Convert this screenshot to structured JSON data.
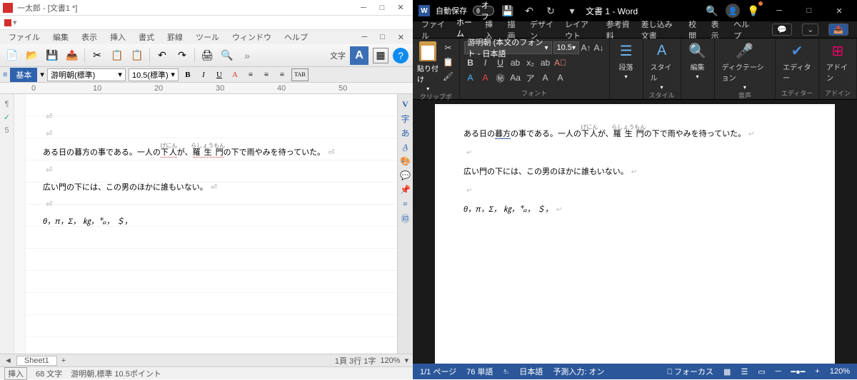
{
  "ichitaro": {
    "title": "一太郎 - [文書1 *]",
    "menu": [
      "ファイル",
      "編集",
      "表示",
      "挿入",
      "書式",
      "罫線",
      "ツール",
      "ウィンドウ",
      "ヘルプ"
    ],
    "textLabel": "文字",
    "bigA": "A",
    "basic": "基本",
    "font": "游明朝(標準)",
    "size": "10.5(標準)",
    "fmt": {
      "B": "B",
      "I": "I",
      "U": "U",
      "tab": "TAB"
    },
    "rulerMarks": [
      "0",
      "10",
      "20",
      "30",
      "40",
      "50"
    ],
    "doc": {
      "line1_a": "ある日の暮方の事である。一人の",
      "line1_ruby1": "下人",
      "line1_rt1": "げにん",
      "line1_b": "が、",
      "line1_ruby2": "羅生門",
      "line1_rt2": "らしょうもん",
      "line1_c": "の下で雨やみを待っていた。",
      "line2": "広い門の下には、この男のほかに誰もいない。",
      "line3": "θ，π，Σ， ㎏，㌔， ＄，"
    },
    "sheet": "Sheet1",
    "statPage": "1頁  3行  1字",
    "statZoom": "120%",
    "statIns": "挿入",
    "statChars": "68 文字",
    "statFont": "游明朝,標準  10.5ポイント"
  },
  "word": {
    "autosave": "自動保存",
    "off": "オフ",
    "title": "文書 1 - Word",
    "searchPH": "検索",
    "tabs": [
      "ファイル",
      "ホーム",
      "挿入",
      "描画",
      "デザイン",
      "レイアウト",
      "参考資料",
      "差し込み文書",
      "校閲",
      "表示",
      "ヘルプ"
    ],
    "paste": "貼り付け",
    "clip": "クリップボード",
    "fontGrp": "フォント",
    "fontName": "游明朝 (本文のフォント - 日本語",
    "fontSize": "10.5",
    "para": "段落",
    "style": "スタイル",
    "edit": "編集",
    "dict": "ディクテーション",
    "editor": "エディター",
    "addin": "アドイン",
    "voice": "音声",
    "doc": {
      "line1_a": "ある日の",
      "line1_u": "暮方",
      "line1_b": "の事である。一人の",
      "line1_ruby1": "下人",
      "line1_rt1": "げにん",
      "line1_c": "が、",
      "line1_ruby2": "羅生門",
      "line1_rt2": "らしょうもん",
      "line1_d": "の下で雨やみを待っていた。",
      "line2": "広い門の下には、この男のほかに誰もいない。",
      "line3": "θ，π，Σ， ㎏，㌔， ＄，"
    },
    "stat": {
      "page": "1/1 ページ",
      "words": "76 単語",
      "lang": "日本語",
      "pred": "予測入力: オン",
      "focus": "フォーカス",
      "zoom": "120%"
    }
  }
}
